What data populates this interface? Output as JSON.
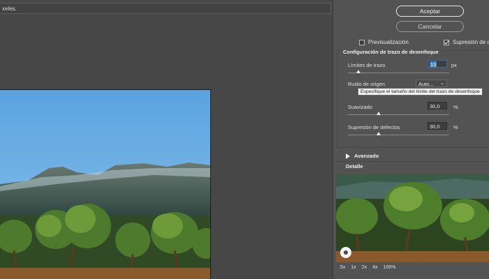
{
  "hint": {
    "text": "xeles."
  },
  "buttons": {
    "ok_label": "Aceptar",
    "cancel_label": "Cancelar"
  },
  "options": {
    "preview_label": "Previsualización",
    "preview_checked": false,
    "artifact_label": "Supresión de defe",
    "artifact_checked": true
  },
  "blur_trace": {
    "title": "Configuración de trazo de desenfoque",
    "limits_label": "Límites de trazo",
    "limits_value": "13",
    "limits_unit": "px",
    "source_noise_label": "Ruido de origen",
    "source_noise_value": "Auto...",
    "tooltip": "Especifique el tamaño del límite del trazo de desenfoque",
    "smoothing_label": "Suavizado",
    "smoothing_value": "30,0",
    "smoothing_unit": "%",
    "artifact_label": "Supresión de defectos",
    "artifact_value": "30,0",
    "artifact_unit": "%"
  },
  "advanced": {
    "label": "Avanzado"
  },
  "detail": {
    "title": "Detalle",
    "zoom_levels": [
      ".5x",
      "1x",
      "2x",
      "4x",
      "100%"
    ]
  },
  "colors": {
    "accent_blue": "#3d82c4",
    "panel_bg": "#535353",
    "canvas_bg": "#474747"
  }
}
